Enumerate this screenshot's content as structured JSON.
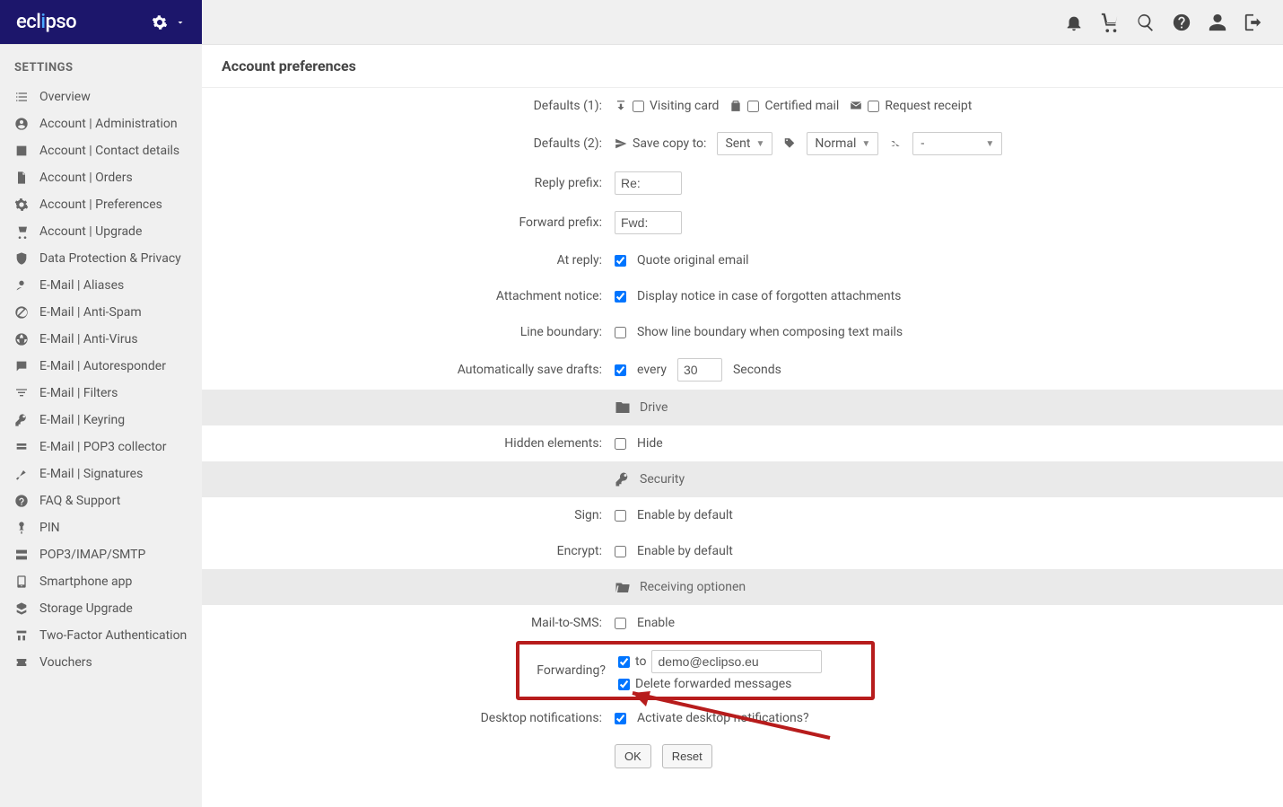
{
  "brand": {
    "part1": "ecl",
    "accent": "i",
    "part2": "pso"
  },
  "sidebar": {
    "title": "SETTINGS",
    "items": [
      {
        "label": "Overview",
        "icon": "list"
      },
      {
        "label": "Account | Administration",
        "icon": "user-circle"
      },
      {
        "label": "Account | Contact details",
        "icon": "id-card"
      },
      {
        "label": "Account | Orders",
        "icon": "doc"
      },
      {
        "label": "Account | Preferences",
        "icon": "gear"
      },
      {
        "label": "Account | Upgrade",
        "icon": "cart"
      },
      {
        "label": "Data Protection & Privacy",
        "icon": "shield"
      },
      {
        "label": "E-Mail | Aliases",
        "icon": "alias"
      },
      {
        "label": "E-Mail | Anti-Spam",
        "icon": "nospam"
      },
      {
        "label": "E-Mail | Anti-Virus",
        "icon": "globe-shield"
      },
      {
        "label": "E-Mail | Autoresponder",
        "icon": "chat"
      },
      {
        "label": "E-Mail | Filters",
        "icon": "filter"
      },
      {
        "label": "E-Mail | Keyring",
        "icon": "key"
      },
      {
        "label": "E-Mail | POP3 collector",
        "icon": "collect"
      },
      {
        "label": "E-Mail | Signatures",
        "icon": "sign"
      },
      {
        "label": "FAQ & Support",
        "icon": "help"
      },
      {
        "label": "PIN",
        "icon": "pin"
      },
      {
        "label": "POP3/IMAP/SMTP",
        "icon": "server"
      },
      {
        "label": "Smartphone app",
        "icon": "phone"
      },
      {
        "label": "Storage Upgrade",
        "icon": "storage"
      },
      {
        "label": "Two-Factor Authentication",
        "icon": "2fa"
      },
      {
        "label": "Vouchers",
        "icon": "voucher"
      }
    ]
  },
  "page": {
    "title": "Account preferences"
  },
  "form": {
    "defaults1": {
      "label": "Defaults (1):",
      "visiting_card": "Visiting card",
      "certified_mail": "Certified mail",
      "request_receipt": "Request receipt"
    },
    "defaults2": {
      "label": "Defaults (2):",
      "save_copy_to": "Save copy to:",
      "sent": "Sent",
      "priority": "Normal",
      "extra": "-"
    },
    "reply_prefix": {
      "label": "Reply prefix:",
      "value": "Re:"
    },
    "forward_prefix": {
      "label": "Forward prefix:",
      "value": "Fwd:"
    },
    "at_reply": {
      "label": "At reply:",
      "text": "Quote original email"
    },
    "attachment_notice": {
      "label": "Attachment notice:",
      "text": "Display notice in case of forgotten attachments"
    },
    "line_boundary": {
      "label": "Line boundary:",
      "text": "Show line boundary when composing text mails"
    },
    "autosave": {
      "label": "Automatically save drafts:",
      "every": "every",
      "value": "30",
      "seconds": "Seconds"
    },
    "drive": {
      "title": "Drive"
    },
    "hidden_elements": {
      "label": "Hidden elements:",
      "text": "Hide"
    },
    "security": {
      "title": "Security"
    },
    "sign": {
      "label": "Sign:",
      "text": "Enable by default"
    },
    "encrypt": {
      "label": "Encrypt:",
      "text": "Enable by default"
    },
    "receiving": {
      "title": "Receiving optionen"
    },
    "mail_to_sms": {
      "label": "Mail-to-SMS:",
      "text": "Enable"
    },
    "forwarding": {
      "label": "Forwarding?",
      "to": "to",
      "email": "demo@eclipso.eu",
      "delete_text": "Delete forwarded messages"
    },
    "desktop_notif": {
      "label": "Desktop notifications:",
      "text": "Activate desktop notifications?"
    },
    "buttons": {
      "ok": "OK",
      "reset": "Reset"
    }
  }
}
